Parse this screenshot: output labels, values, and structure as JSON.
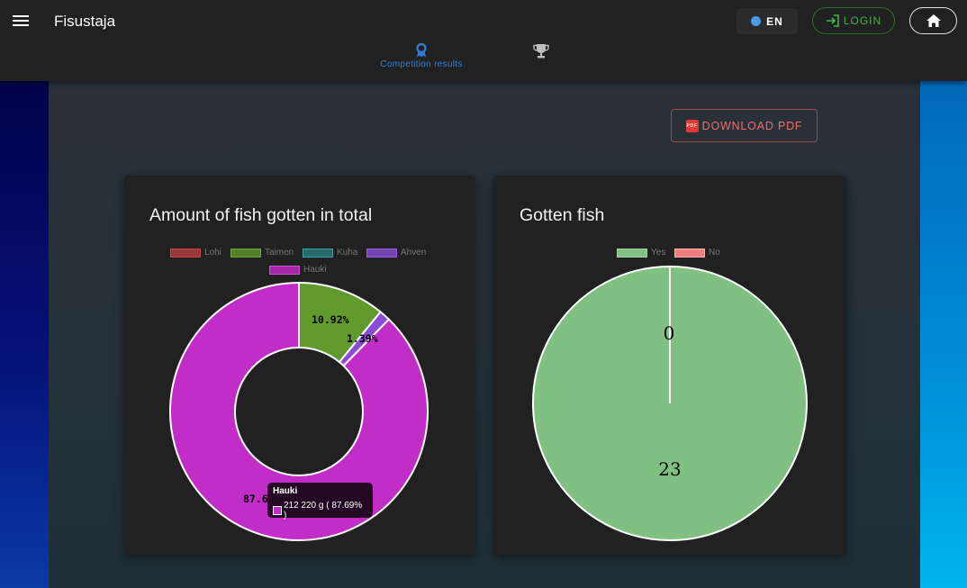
{
  "app": {
    "title": "Fisustaja"
  },
  "header": {
    "lang_label": "EN",
    "login_label": "LOGIN"
  },
  "tabs": [
    {
      "label": "Competition results",
      "icon": "award-ribbon-icon",
      "active": true
    },
    {
      "label": "",
      "icon": "trophy-icon",
      "active": false
    }
  ],
  "actions": {
    "download_pdf": "DOWNLOAD PDF"
  },
  "charts": {
    "fish": {
      "title": "Amount of fish gotten in total",
      "legend": [
        "Lohi",
        "Taimen",
        "Kuha",
        "Ahven",
        "Hauki"
      ],
      "tooltip": {
        "title": "Hauki",
        "value": "212 220 g ( 87.69% )"
      },
      "label_taimen": "10.92%",
      "label_ahven": "1.39%",
      "label_hauki": "87.6"
    },
    "gotten": {
      "title": "Gotten fish",
      "legend": [
        "Yes",
        "No"
      ],
      "label_no": "0",
      "label_yes": "23"
    }
  },
  "colors": {
    "lohi": "#cc4444",
    "taimen": "#5f9a2b",
    "kuha": "#2a8a8c",
    "ahven": "#8a4bd6",
    "hauki": "#c22cc7",
    "yes": "#81c083",
    "no": "#ef7f7f",
    "accent_blue": "#2f7fd8",
    "login_green": "#4caf50",
    "pdf_red": "#ef6f6a"
  },
  "chart_data": [
    {
      "type": "pie",
      "title": "Amount of fish gotten in total",
      "categories": [
        "Lohi",
        "Taimen",
        "Kuha",
        "Ahven",
        "Hauki"
      ],
      "values": [
        0,
        10.92,
        0,
        1.39,
        87.69
      ],
      "units": "%",
      "donut": true
    },
    {
      "type": "pie",
      "title": "Gotten fish",
      "categories": [
        "Yes",
        "No"
      ],
      "values": [
        23,
        0
      ]
    }
  ]
}
